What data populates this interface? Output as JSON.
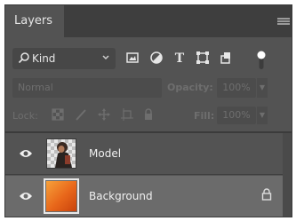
{
  "panel": {
    "tab_label": "Layers"
  },
  "filter": {
    "kind_label": "Kind",
    "icons": [
      "pixel-filter-icon",
      "adjustment-filter-icon",
      "type-filter-icon",
      "shape-filter-icon",
      "smartobject-filter-icon",
      "filter-toggle-icon"
    ]
  },
  "blend": {
    "mode": "Normal",
    "opacity_label": "Opacity:",
    "opacity_value": "100%"
  },
  "lock": {
    "label": "Lock:",
    "icons": [
      "lock-transparent-icon",
      "lock-image-icon",
      "lock-position-icon",
      "lock-artboard-icon",
      "lock-all-icon"
    ],
    "fill_label": "Fill:",
    "fill_value": "100%"
  },
  "layers": [
    {
      "name": "Model",
      "visible": true,
      "locked": false
    },
    {
      "name": "Background",
      "visible": true,
      "locked": true
    }
  ],
  "colors": {
    "panel_bg": "#535353",
    "selected_row": "#6b6b6b",
    "text": "#f0f0f0",
    "disabled_text": "#6e6e6e"
  }
}
